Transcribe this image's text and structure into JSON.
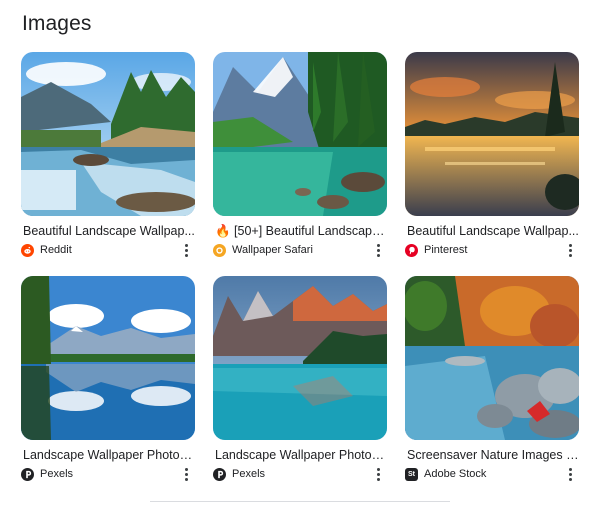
{
  "section": {
    "title": "Images"
  },
  "results": [
    {
      "title": "Beautiful Landscape Wallpap...",
      "source": "Reddit",
      "favicon_color": "#ff4500",
      "favicon_icon": "reddit-icon"
    },
    {
      "title": "🔥 [50+] Beautiful Landscape ...",
      "source": "Wallpaper Safari",
      "favicon_color": "#f5a623",
      "favicon_icon": "wallpaper-safari-icon"
    },
    {
      "title": "Beautiful Landscape Wallpap...",
      "source": "Pinterest",
      "favicon_color": "#e60023",
      "favicon_icon": "pinterest-icon"
    },
    {
      "title": "Landscape Wallpaper Photos...",
      "source": "Pexels",
      "favicon_color": "#202124",
      "favicon_icon": "pexels-icon"
    },
    {
      "title": "Landscape Wallpaper Photos...",
      "source": "Pexels",
      "favicon_color": "#202124",
      "favicon_icon": "pexels-icon"
    },
    {
      "title": "Screensaver Nature Images –...",
      "source": "Adobe Stock",
      "favicon_color": "#202124",
      "favicon_icon": "adobe-stock-icon",
      "favicon_text": "St"
    }
  ]
}
